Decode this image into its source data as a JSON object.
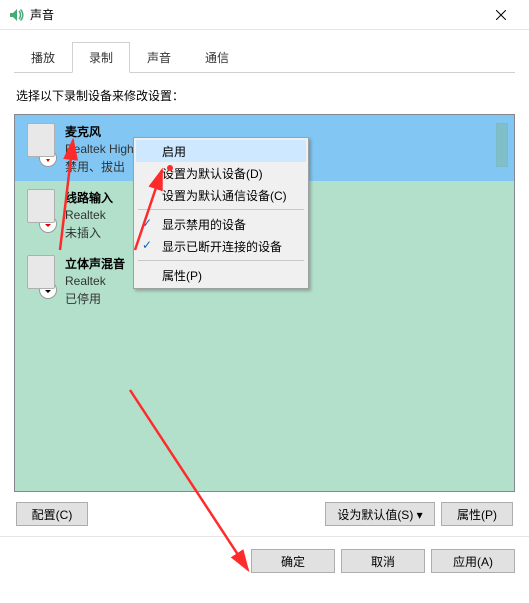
{
  "window": {
    "title": "声音"
  },
  "tabs": {
    "t0": "播放",
    "t1": "录制",
    "t2": "声音",
    "t3": "通信"
  },
  "instruction": "选择以下录制设备来修改设置：",
  "devices": [
    {
      "name": "麦克风",
      "sub1": "Realtek High Definition Audio",
      "sub2": "禁用、拔出"
    },
    {
      "name": "线路输入",
      "sub1": "Realtek",
      "sub2": "未插入"
    },
    {
      "name": "立体声混音",
      "sub1": "Realtek",
      "sub2": "已停用"
    }
  ],
  "context_menu": {
    "enable": "启用",
    "set_default": "设置为默认设备(D)",
    "set_comm_default": "设置为默认通信设备(C)",
    "show_disabled": "显示禁用的设备",
    "show_disconnected": "显示已断开连接的设备",
    "properties": "属性(P)"
  },
  "buttons": {
    "configure": "配置(C)",
    "set_default_btn": "设为默认值(S) ▾",
    "properties_btn": "属性(P)",
    "ok": "确定",
    "cancel": "取消",
    "apply": "应用(A)"
  }
}
